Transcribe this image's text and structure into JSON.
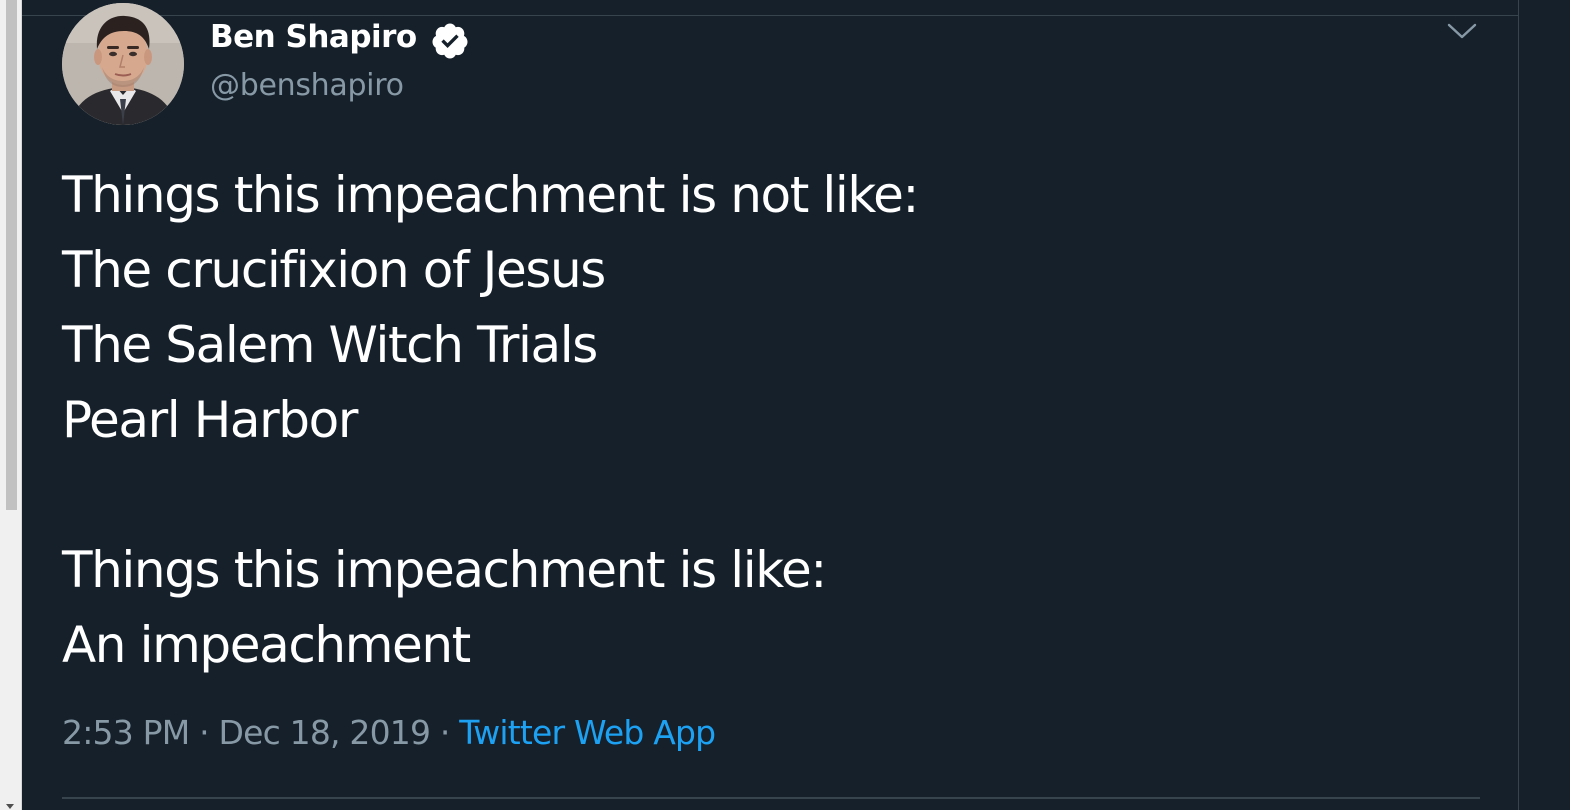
{
  "tweet": {
    "author": {
      "display_name": "Ben Shapiro",
      "handle": "@benshapiro",
      "verified": true
    },
    "text_lines": [
      "Things this impeachment is not like:",
      "The crucifixion of Jesus",
      "The Salem Witch Trials",
      "Pearl Harbor",
      "",
      "Things this impeachment is like:",
      "An impeachment"
    ],
    "time": "2:53 PM",
    "date": "Dec 18, 2019",
    "separator": "·",
    "source": "Twitter Web App"
  },
  "icons": {
    "verified": "verified-badge-icon",
    "menu": "chevron-down-icon"
  },
  "colors": {
    "background": "#15202b",
    "primary_text": "#ffffff",
    "secondary_text": "#8899a6",
    "link": "#1da1f2",
    "border": "#38444d"
  }
}
